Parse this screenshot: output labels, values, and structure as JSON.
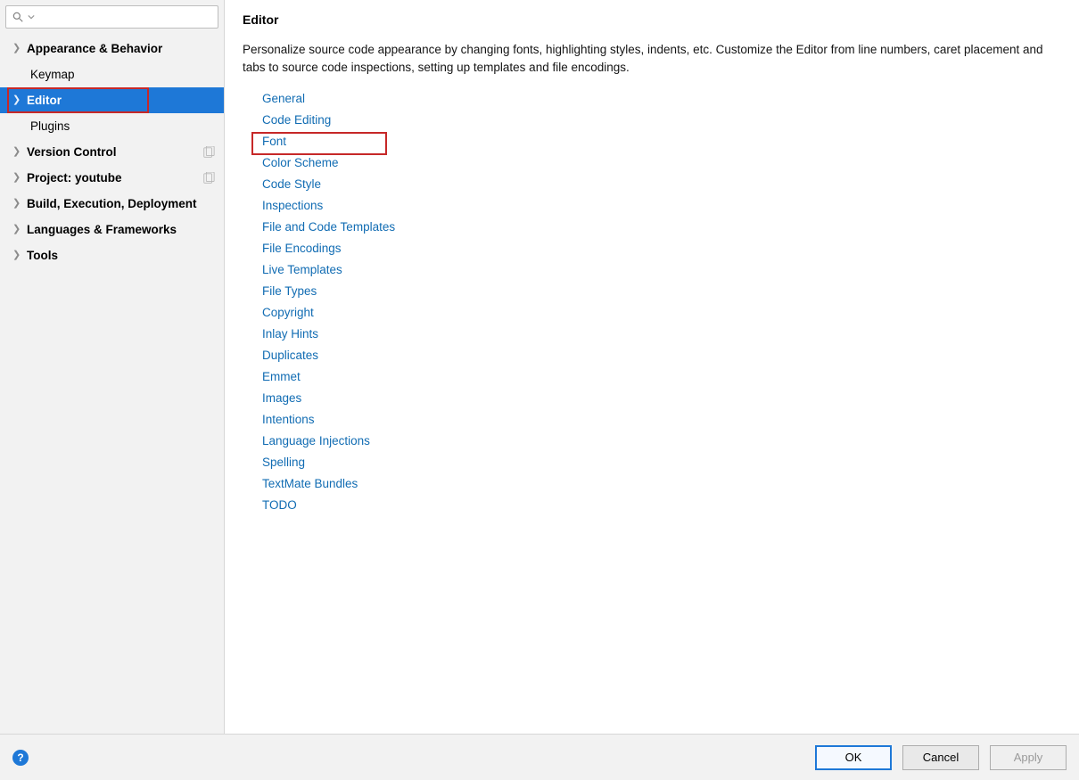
{
  "search": {
    "placeholder": ""
  },
  "sidebar": {
    "items": [
      {
        "label": "Appearance & Behavior",
        "expandable": true,
        "bold": true,
        "selected": false,
        "projIcon": false,
        "highlighted": false
      },
      {
        "label": "Keymap",
        "expandable": false,
        "bold": false,
        "selected": false,
        "projIcon": false,
        "highlighted": false
      },
      {
        "label": "Editor",
        "expandable": true,
        "bold": true,
        "selected": true,
        "projIcon": false,
        "highlighted": true
      },
      {
        "label": "Plugins",
        "expandable": false,
        "bold": false,
        "selected": false,
        "projIcon": false,
        "highlighted": false
      },
      {
        "label": "Version Control",
        "expandable": true,
        "bold": true,
        "selected": false,
        "projIcon": true,
        "highlighted": false
      },
      {
        "label": "Project: youtube",
        "expandable": true,
        "bold": true,
        "selected": false,
        "projIcon": true,
        "highlighted": false
      },
      {
        "label": "Build, Execution, Deployment",
        "expandable": true,
        "bold": true,
        "selected": false,
        "projIcon": false,
        "highlighted": false
      },
      {
        "label": "Languages & Frameworks",
        "expandable": true,
        "bold": true,
        "selected": false,
        "projIcon": false,
        "highlighted": false
      },
      {
        "label": "Tools",
        "expandable": true,
        "bold": true,
        "selected": false,
        "projIcon": false,
        "highlighted": false
      }
    ]
  },
  "content": {
    "title": "Editor",
    "description": "Personalize source code appearance by changing fonts, highlighting styles, indents, etc. Customize the Editor from line numbers, caret placement and tabs to source code inspections, setting up templates and file encodings.",
    "links": [
      {
        "label": "General",
        "highlighted": false
      },
      {
        "label": "Code Editing",
        "highlighted": false
      },
      {
        "label": "Font",
        "highlighted": true
      },
      {
        "label": "Color Scheme",
        "highlighted": false
      },
      {
        "label": "Code Style",
        "highlighted": false
      },
      {
        "label": "Inspections",
        "highlighted": false
      },
      {
        "label": "File and Code Templates",
        "highlighted": false
      },
      {
        "label": "File Encodings",
        "highlighted": false
      },
      {
        "label": "Live Templates",
        "highlighted": false
      },
      {
        "label": "File Types",
        "highlighted": false
      },
      {
        "label": "Copyright",
        "highlighted": false
      },
      {
        "label": "Inlay Hints",
        "highlighted": false
      },
      {
        "label": "Duplicates",
        "highlighted": false
      },
      {
        "label": "Emmet",
        "highlighted": false
      },
      {
        "label": "Images",
        "highlighted": false
      },
      {
        "label": "Intentions",
        "highlighted": false
      },
      {
        "label": "Language Injections",
        "highlighted": false
      },
      {
        "label": "Spelling",
        "highlighted": false
      },
      {
        "label": "TextMate Bundles",
        "highlighted": false
      },
      {
        "label": "TODO",
        "highlighted": false
      }
    ]
  },
  "footer": {
    "help": "?",
    "ok": "OK",
    "cancel": "Cancel",
    "apply": "Apply"
  }
}
